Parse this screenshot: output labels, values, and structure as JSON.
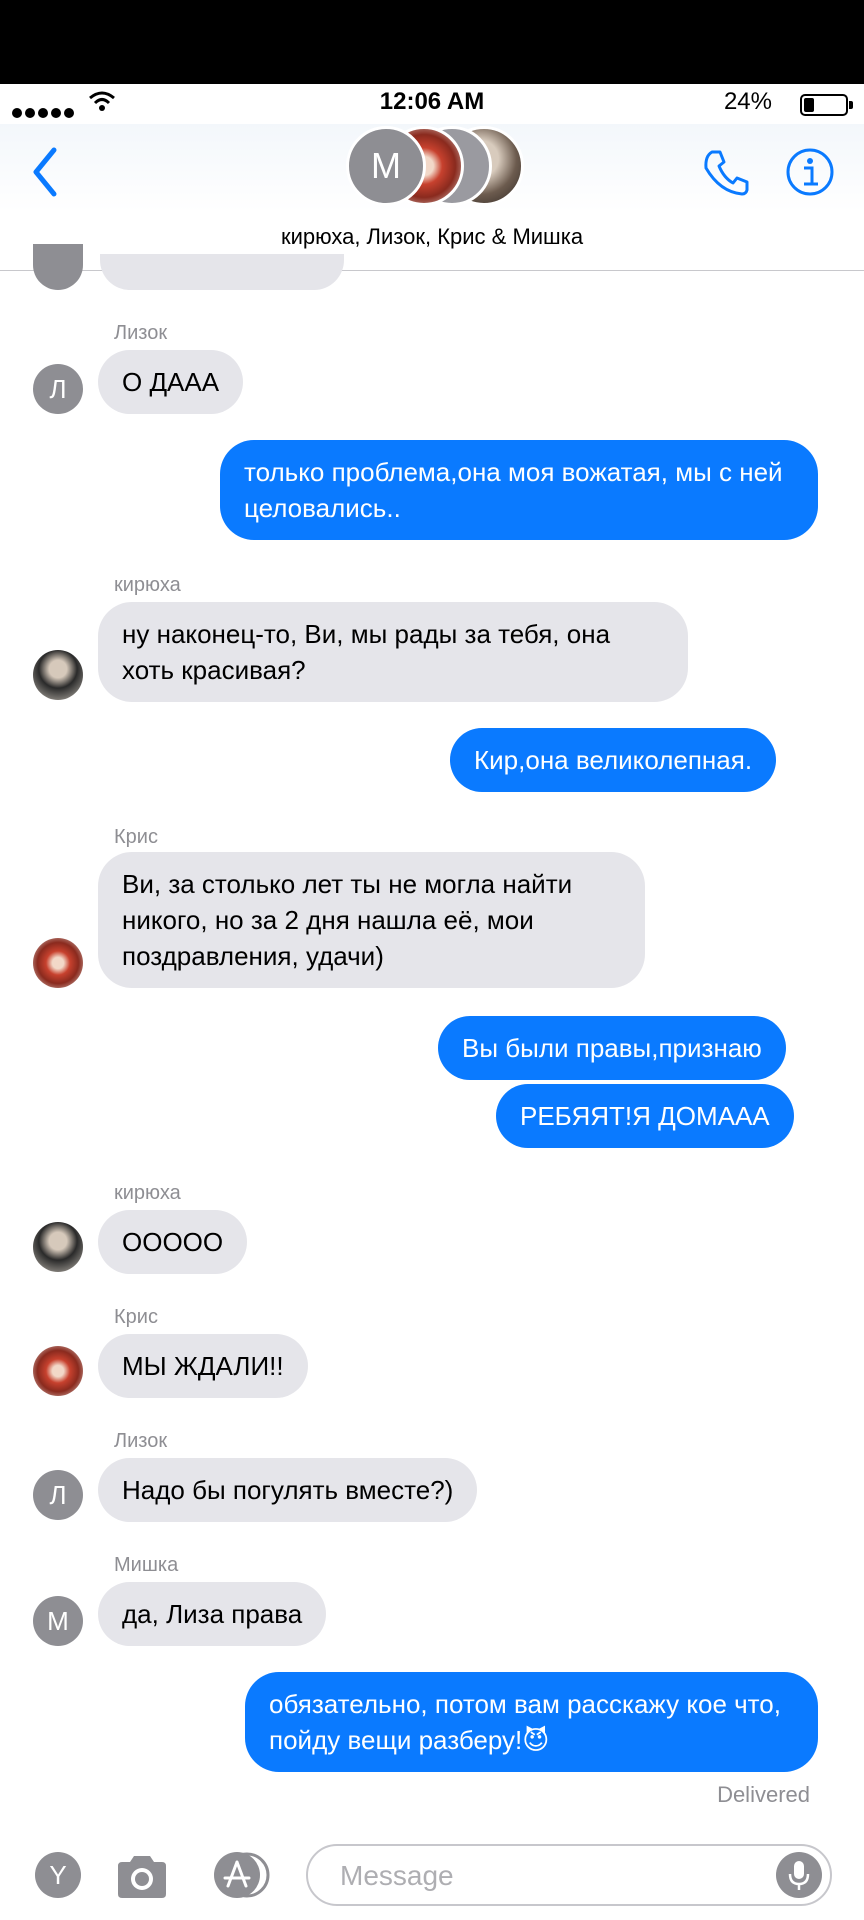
{
  "status_bar": {
    "time": "12:06 AM",
    "battery_pct": "24%",
    "battery_level": 0.24
  },
  "header": {
    "group_name": "кирюха, Лизок, Крис & Мишка",
    "lead_avatar_letter": "М"
  },
  "colors": {
    "outgoing": "#0a7aff",
    "incoming": "#e5e5ea",
    "accent": "#0a7aff"
  },
  "icons": {
    "back": "chevron-left-icon",
    "call": "phone-icon",
    "info": "info-icon",
    "camera": "camera-icon",
    "apps": "app-store-icon",
    "mic": "mic-icon"
  },
  "messages": [
    {
      "sender": "Лизок",
      "avatar_letter": "Л",
      "text": "О ДААА"
    },
    {
      "text": "только проблема,она моя вожатая, мы с ней целовались.."
    },
    {
      "sender": "кирюха",
      "text": "ну наконец-то, Ви, мы рады за тебя, она хоть красивая?"
    },
    {
      "text": "Кир,она великолепная."
    },
    {
      "sender": "Крис",
      "text": "Ви, за столько лет ты не могла найти никого, но за 2 дня нашла её, мои поздравления, удачи)"
    },
    {
      "text": "Вы были правы,признаю"
    },
    {
      "text": "РЕБЯЯТ!Я ДОМААА"
    },
    {
      "sender": "кирюха",
      "text": "ООООО"
    },
    {
      "sender": "Крис",
      "text": "МЫ ЖДАЛИ!!"
    },
    {
      "sender": "Лизок",
      "avatar_letter": "Л",
      "text": "Надо бы погулять вместе?)"
    },
    {
      "sender": "Мишка",
      "avatar_letter": "М",
      "text": "да, Лиза права"
    },
    {
      "text": "обязательно, потом вам расскажу кое что, пойду вещи разберу!😈"
    }
  ],
  "delivered_label": "Delivered",
  "input": {
    "placeholder": "Message",
    "profile_letter": "Y"
  }
}
